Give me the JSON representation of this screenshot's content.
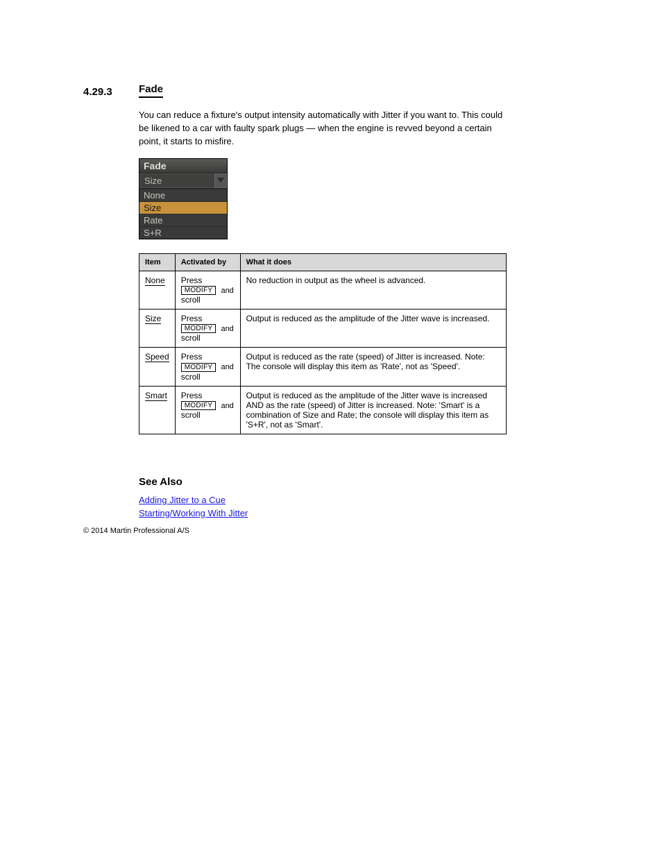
{
  "section": {
    "number": "4.29.3",
    "title": "Fade"
  },
  "intro": "You can reduce a fixture's output intensity automatically with Jitter if you want to. This could be likened to a car with faulty spark plugs — when the engine is revved beyond a certain point, it starts to misfire.",
  "fade_widget": {
    "title": "Fade",
    "selected": "Size",
    "options": [
      "None",
      "Size",
      "Rate",
      "S+R"
    ]
  },
  "table": {
    "headers": [
      "Item",
      "Activated by",
      "What it does"
    ],
    "rows": [
      {
        "item": "None",
        "activated_prefix": "Press ",
        "activated_button": "MODIFY",
        "desc": "No reduction in output as the wheel is advanced."
      },
      {
        "item": "Size",
        "activated_prefix": "Press ",
        "activated_button": "MODIFY",
        "desc": "Output is reduced as the amplitude of the Jitter wave is increased."
      },
      {
        "item": "Speed",
        "activated_prefix": "Press ",
        "activated_button": "MODIFY",
        "desc": "Output is reduced as the rate (speed) of Jitter is increased. Note: The console will display this item as 'Rate', not as 'Speed'."
      },
      {
        "item": "Smart",
        "activated_prefix": "Press ",
        "activated_button": "MODIFY",
        "desc": "Output is reduced as the amplitude of the Jitter wave is increased AND as the rate (speed) of Jitter is increased. Note: 'Smart' is a combination of Size and Rate; the console will display this item as 'S+R', not as 'Smart'."
      }
    ],
    "and_text": " and ",
    "scroll_text": "scroll"
  },
  "see_also": {
    "heading": "See Also",
    "links": [
      "Adding Jitter to a Cue",
      "Starting/Working With Jitter"
    ]
  },
  "footer": "© 2014 Martin Professional A/S"
}
